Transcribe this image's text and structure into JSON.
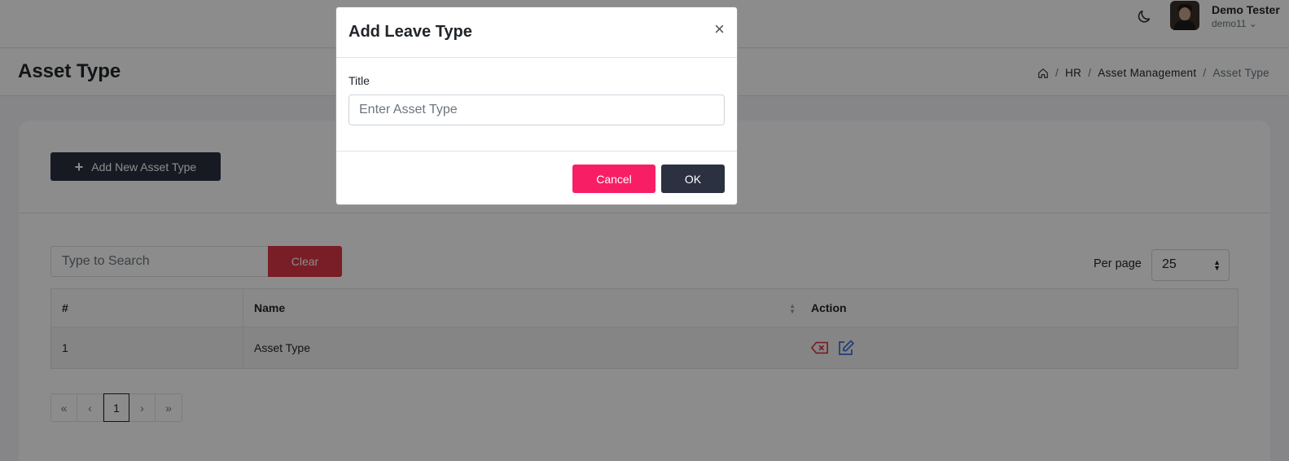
{
  "header": {
    "theme_toggle_icon": "moon-icon",
    "user_name": "Demo Tester",
    "user_handle": "demo11 ⌄"
  },
  "page": {
    "title": "Asset Type",
    "breadcrumb": [
      "HR",
      "Asset Management",
      "Asset Type"
    ],
    "breadcrumb_separator": "/"
  },
  "toolbar": {
    "add_button_icon": "+",
    "add_button_label": "Add New Asset Type"
  },
  "search": {
    "placeholder": "Type to Search",
    "clear_label": "Clear"
  },
  "per_page": {
    "label": "Per page",
    "selected": "25"
  },
  "table": {
    "columns": [
      "#",
      "Name",
      "Action"
    ],
    "rows": [
      {
        "index": "1",
        "name": "Asset Type"
      }
    ]
  },
  "pagination": {
    "first": "«",
    "prev": "‹",
    "current": "1",
    "next": "›",
    "last": "»"
  },
  "modal": {
    "title": "Add Leave Type",
    "close": "×",
    "field_label": "Title",
    "field_placeholder": "Enter Asset Type",
    "field_value": "",
    "cancel_label": "Cancel",
    "ok_label": "OK"
  },
  "colors": {
    "primary_dark": "#2b3140",
    "danger": "#dc3545",
    "cancel_pink": "#f81e66",
    "edit_blue": "#3b6fd8",
    "delete_red": "#dc3545"
  }
}
